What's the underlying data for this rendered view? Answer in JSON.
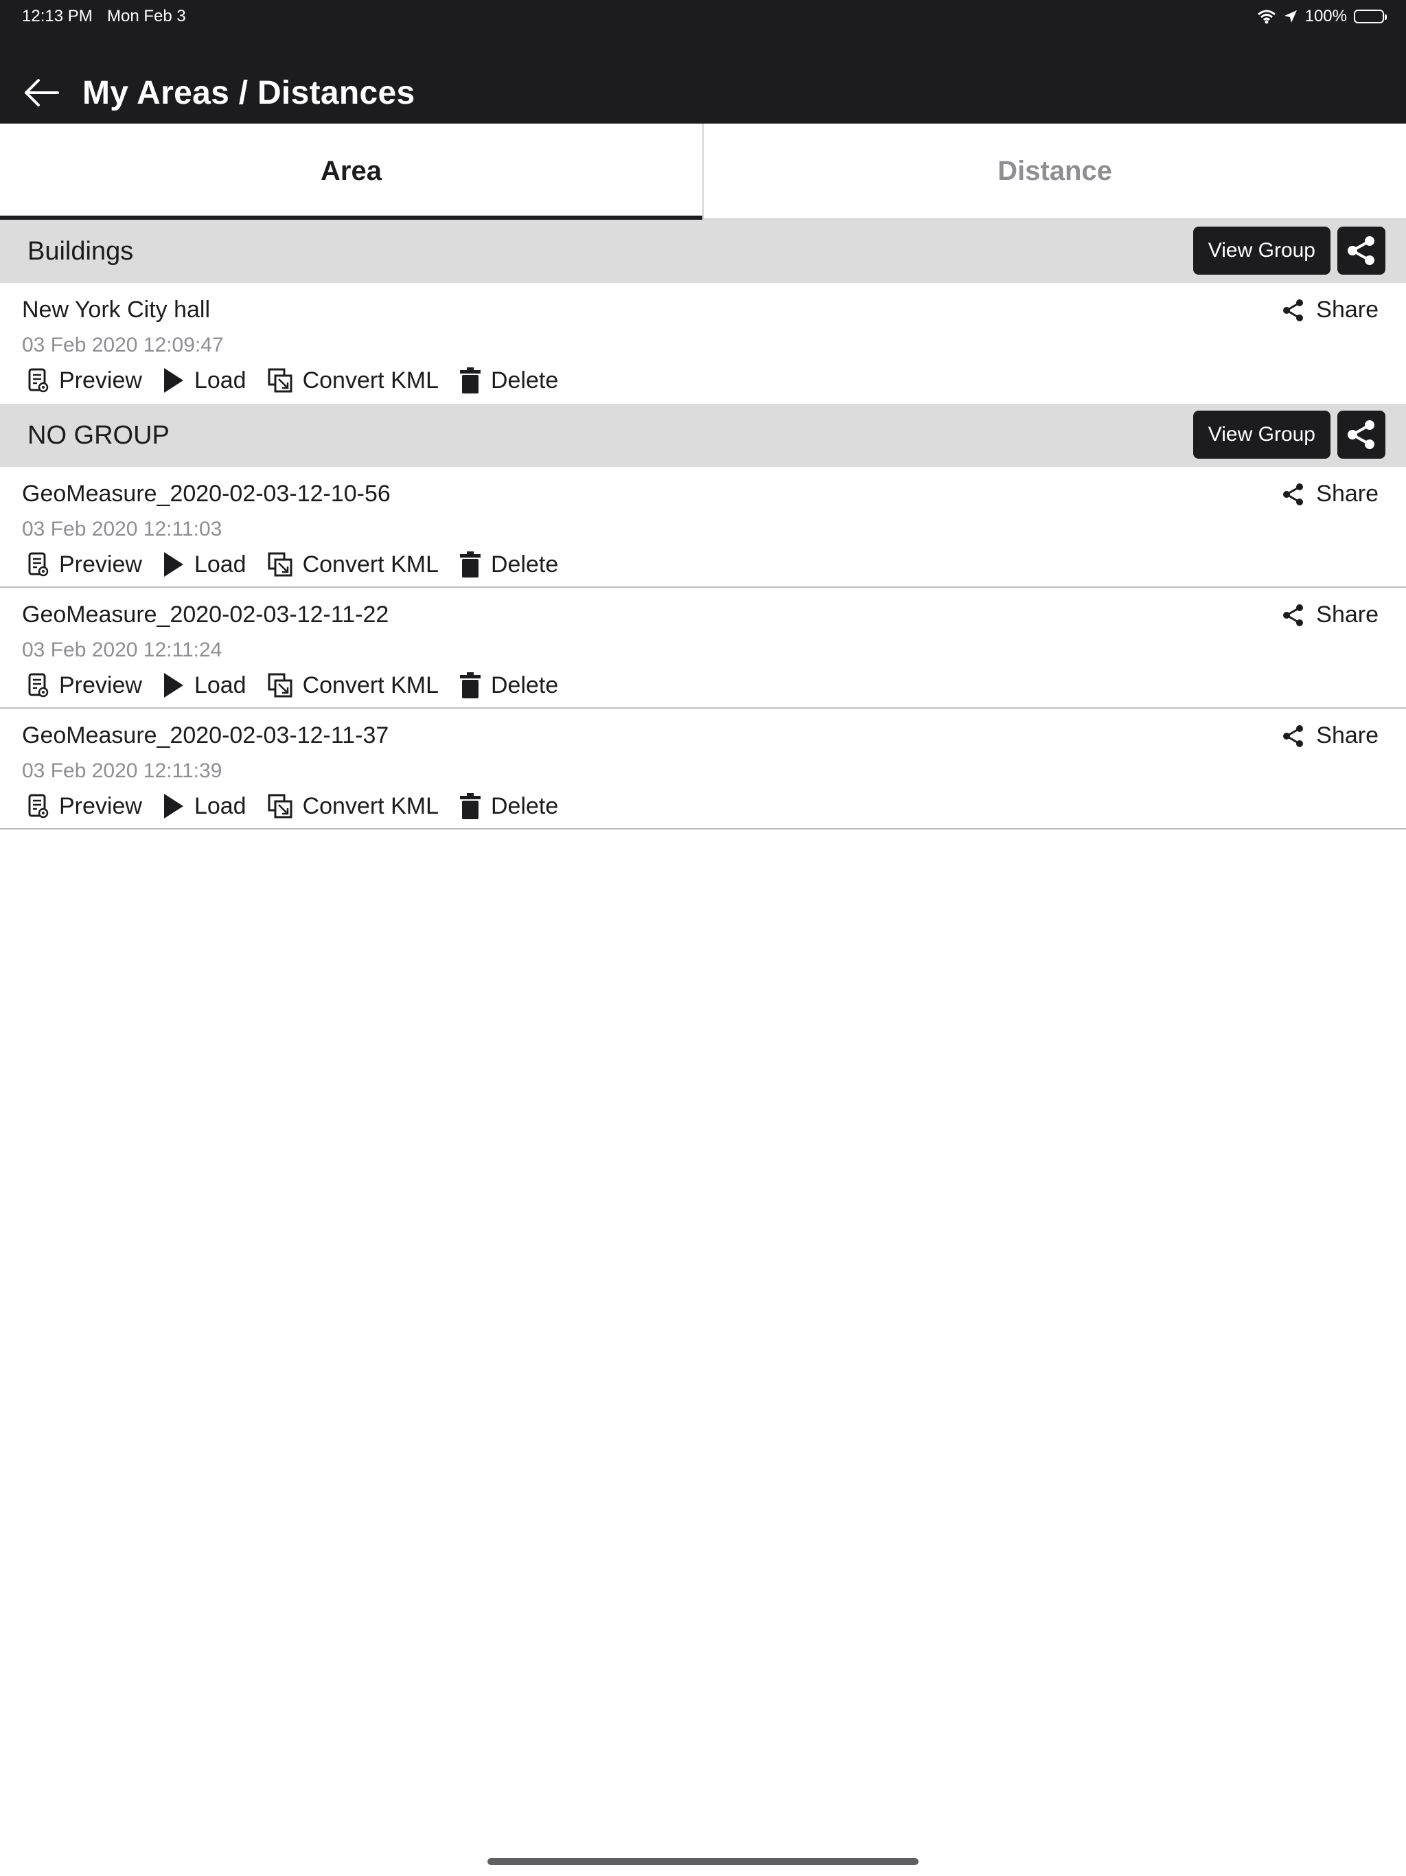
{
  "status_bar": {
    "time": "12:13 PM",
    "date": "Mon Feb 3",
    "battery": "100%",
    "icons": [
      "wifi-icon",
      "location-arrow-icon",
      "battery-icon"
    ]
  },
  "header": {
    "title": "My Areas / Distances",
    "back_icon": "arrow-left-icon"
  },
  "tabs": [
    {
      "label": "Area",
      "active": true
    },
    {
      "label": "Distance",
      "active": false
    }
  ],
  "colors": {
    "header_bg": "#1c1c1e",
    "group_bg": "#dcdcdc",
    "muted_text": "#8e8e93"
  },
  "action_labels": {
    "preview": "Preview",
    "load": "Load",
    "convert": "Convert KML",
    "delete": "Delete",
    "share": "Share",
    "view_group": "View Group"
  },
  "groups": [
    {
      "title": "Buildings",
      "entries": [
        {
          "name": "New York City hall",
          "date": "03 Feb 2020 12:09:47"
        }
      ]
    },
    {
      "title": "NO GROUP",
      "entries": [
        {
          "name": "GeoMeasure_2020-02-03-12-10-56",
          "date": "03 Feb 2020 12:11:03"
        },
        {
          "name": "GeoMeasure_2020-02-03-12-11-22",
          "date": "03 Feb 2020 12:11:24"
        },
        {
          "name": "GeoMeasure_2020-02-03-12-11-37",
          "date": "03 Feb 2020 12:11:39"
        }
      ]
    }
  ]
}
